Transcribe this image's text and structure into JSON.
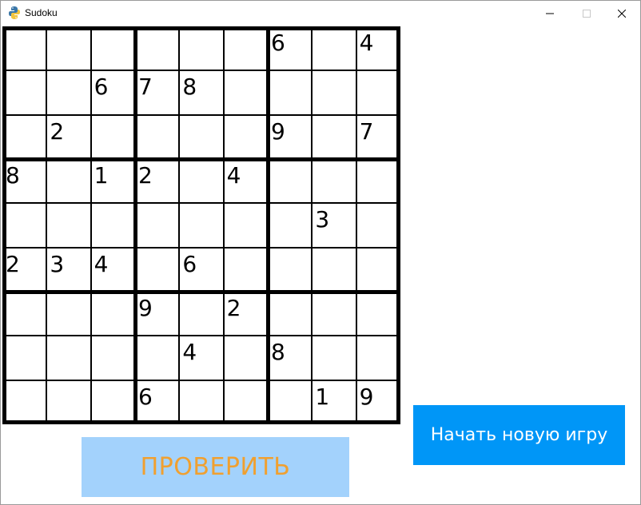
{
  "window": {
    "title": "Sudoku",
    "icon": "python-snake-icon"
  },
  "board": {
    "size": 9,
    "cells": [
      [
        "",
        "",
        "",
        "",
        "",
        "",
        "6",
        "",
        "4"
      ],
      [
        "",
        "",
        "6",
        "7",
        "8",
        "",
        "",
        "",
        ""
      ],
      [
        "",
        "2",
        "",
        "",
        "",
        "",
        "9",
        "",
        "7"
      ],
      [
        "8",
        "",
        "1",
        "2",
        "",
        "4",
        "",
        "",
        ""
      ],
      [
        "",
        "",
        "",
        "",
        "",
        "",
        "",
        "3",
        ""
      ],
      [
        "2",
        "3",
        "4",
        "",
        "6",
        "",
        "",
        "",
        ""
      ],
      [
        "",
        "",
        "",
        "9",
        "",
        "2",
        "",
        "",
        ""
      ],
      [
        "",
        "",
        "",
        "",
        "4",
        "",
        "8",
        "",
        ""
      ],
      [
        "",
        "",
        "",
        "6",
        "",
        "",
        "",
        "1",
        "9"
      ]
    ]
  },
  "buttons": {
    "check_label": "ПРОВЕРИТЬ",
    "new_game_label": "Начать новую игру"
  },
  "colors": {
    "check_bg": "#a3d2fc",
    "check_text": "#f0a030",
    "new_game_bg": "#0096f7",
    "new_game_text": "#ffffff"
  }
}
